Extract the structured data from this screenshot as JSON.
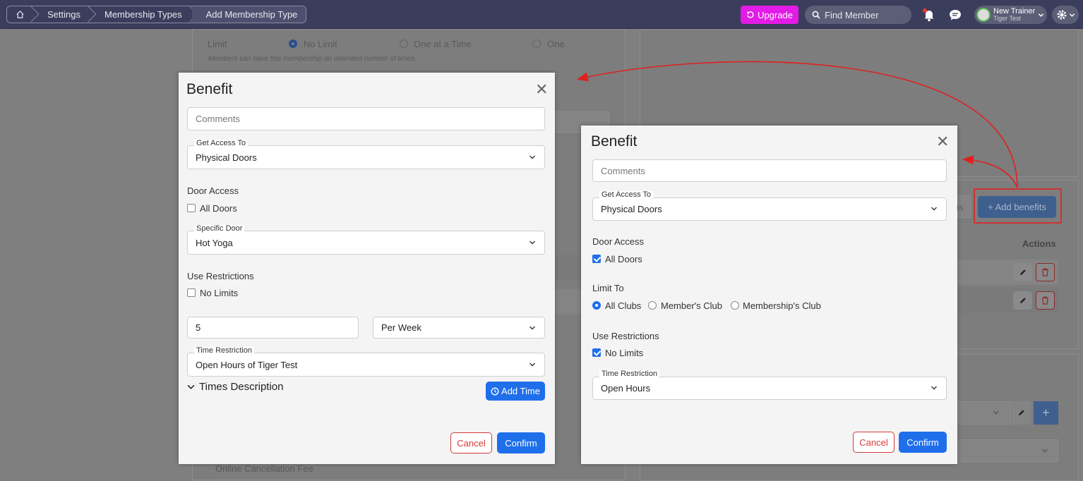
{
  "breadcrumb": [
    "Settings",
    "Membership Types",
    "Add Membership Type"
  ],
  "topbar": {
    "upgrade_label": "Upgrade",
    "find_placeholder": "Find Member",
    "user_name": "New Trainer",
    "user_sub": "Tiger Test",
    "colors": {
      "bar": "#3b3d5c",
      "upgrade": "#e21be6"
    }
  },
  "background": {
    "limit_label": "Limit",
    "limit_options": [
      "No Limit",
      "One at a Time",
      "One"
    ],
    "limit_hint": "Members can have this membership an unlimited number of times.",
    "add_benefits_label": "+ Add benefits",
    "actions_header": "Actions",
    "cancellation_label": "Online Cancellation Fee"
  },
  "modal_left": {
    "title": "Benefit",
    "comments_placeholder": "Comments",
    "access_legend": "Get Access To",
    "access_value": "Physical Doors",
    "door_access_label": "Door Access",
    "all_doors_label": "All Doors",
    "all_doors_checked": false,
    "specific_door_legend": "Specific Door",
    "specific_door_value": "Hot Yoga",
    "use_restrictions_label": "Use Restrictions",
    "no_limits_label": "No Limits",
    "no_limits_checked": false,
    "count_value": "5",
    "period_value": "Per Week",
    "time_restriction_legend": "Time Restriction",
    "time_restriction_value": "Open Hours of Tiger Test",
    "times_description_label": "Times Description",
    "add_time_label": "Add Time",
    "cancel_label": "Cancel",
    "confirm_label": "Confirm"
  },
  "modal_right": {
    "title": "Benefit",
    "comments_placeholder": "Comments",
    "access_legend": "Get Access To",
    "access_value": "Physical Doors",
    "door_access_label": "Door Access",
    "all_doors_label": "All Doors",
    "all_doors_checked": true,
    "limit_to_label": "Limit To",
    "limit_to_options": [
      "All Clubs",
      "Member's Club",
      "Membership's Club"
    ],
    "limit_to_selected": "All Clubs",
    "use_restrictions_label": "Use Restrictions",
    "no_limits_label": "No Limits",
    "no_limits_checked": true,
    "time_restriction_legend": "Time Restriction",
    "time_restriction_value": "Open Hours",
    "cancel_label": "Cancel",
    "confirm_label": "Confirm"
  },
  "accent_color": "#1f6feb",
  "annotation_color": "#e02020"
}
